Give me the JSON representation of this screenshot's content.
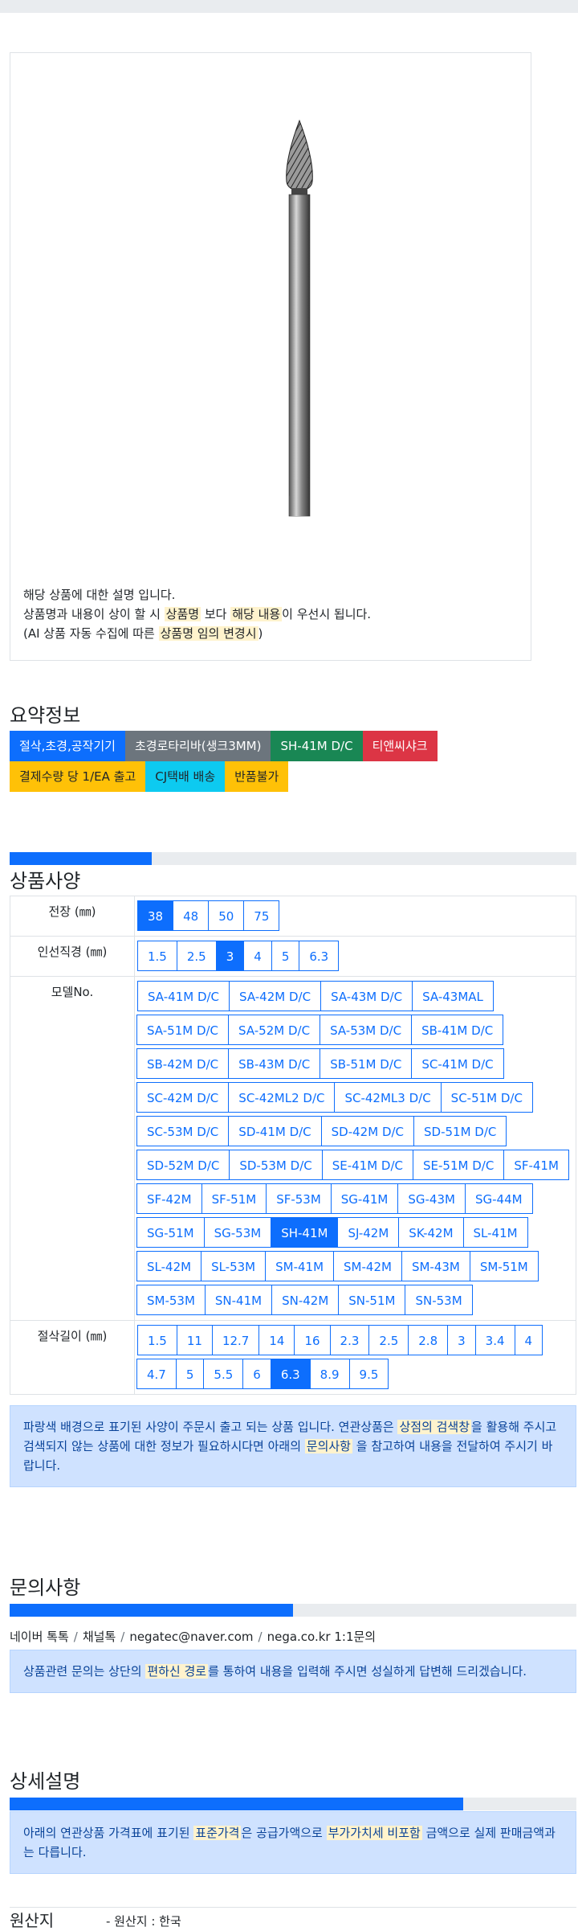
{
  "product": {
    "desc_line1": "해당 상품에 대한 설명 입니다.",
    "desc_line2_a": "상품명과 내용이 상이 할 시 ",
    "desc_line2_hl1": "상품명",
    "desc_line2_b": " 보다 ",
    "desc_line2_hl2": "해당 내용",
    "desc_line2_c": "이 우선시 됩니다.",
    "desc_line3_a": "(AI 상품 자동 수집에 따른 ",
    "desc_line3_hl": "상품명 임의 변경시",
    "desc_line3_b": ")"
  },
  "summary": {
    "title": "요약정보",
    "badges_row1": [
      {
        "label": "절삭,초경,공작기기",
        "color": "blue"
      },
      {
        "label": "초경로타리바(생크3MM)",
        "color": "gray"
      },
      {
        "label": "SH-41M D/C",
        "color": "green"
      },
      {
        "label": "티앤씨샤크",
        "color": "red"
      }
    ],
    "badges_row2": [
      {
        "label": "결제수량 당 1/EA 출고",
        "color": "yellow"
      },
      {
        "label": "CJ택배 배송",
        "color": "cyan"
      },
      {
        "label": "반품불가",
        "color": "yellow"
      }
    ]
  },
  "spec": {
    "title": "상품사양",
    "progress_percent": 25,
    "rows": [
      {
        "label": "전장 (㎜)",
        "options": [
          "38",
          "48",
          "50",
          "75"
        ],
        "selected": "38"
      },
      {
        "label": "인선직경 (㎜)",
        "options": [
          "1.5",
          "2.5",
          "3",
          "4",
          "5",
          "6.3"
        ],
        "selected": "3"
      },
      {
        "label": "모델No.",
        "options": [
          "SA-41M D/C",
          "SA-42M D/C",
          "SA-43M D/C",
          "SA-43MAL",
          "SA-51M D/C",
          "SA-52M D/C",
          "SA-53M D/C",
          "SB-41M D/C",
          "SB-42M D/C",
          "SB-43M D/C",
          "SB-51M D/C",
          "SC-41M D/C",
          "SC-42M D/C",
          "SC-42ML2 D/C",
          "SC-42ML3 D/C",
          "SC-51M D/C",
          "SC-53M D/C",
          "SD-41M D/C",
          "SD-42M D/C",
          "SD-51M D/C",
          "SD-52M D/C",
          "SD-53M D/C",
          "SE-41M D/C",
          "SE-51M D/C",
          "SF-41M",
          "SF-42M",
          "SF-51M",
          "SF-53M",
          "SG-41M",
          "SG-43M",
          "SG-44M",
          "SG-51M",
          "SG-53M",
          "SH-41M",
          "SJ-42M",
          "SK-42M",
          "SL-41M",
          "SL-42M",
          "SL-53M",
          "SM-41M",
          "SM-42M",
          "SM-43M",
          "SM-51M",
          "SM-53M",
          "SN-41M",
          "SN-42M",
          "SN-51M",
          "SN-53M"
        ],
        "selected": "SH-41M"
      },
      {
        "label": "절삭길이 (㎜)",
        "options": [
          "1.5",
          "11",
          "12.7",
          "14",
          "16",
          "2.3",
          "2.5",
          "2.8",
          "3",
          "3.4",
          "4",
          "4.7",
          "5",
          "5.5",
          "6",
          "6.3",
          "8.9",
          "9.5"
        ],
        "selected": "6.3"
      }
    ],
    "notice_a": "파랑색 배경으로 표기된 사양이 주문시 출고 되는 상품 입니다. 연관상품은 ",
    "notice_hl1": "상점의 검색창",
    "notice_b": "을 활용해 주시고 검색되지 않는 상품에 대한 정보가 필요하시다면 아래의 ",
    "notice_hl2": "문의사항",
    "notice_c": " 을 참고하여 내용을 전달하여 주시기 바랍니다."
  },
  "inquiry": {
    "title": "문의사항",
    "progress_percent": 50,
    "links": [
      "네이버 톡톡",
      "채널톡",
      "negatec@naver.com",
      "nega.co.kr 1:1문의"
    ],
    "notice_a": "상품관련 문의는 상단의 ",
    "notice_hl": "편하신 경로",
    "notice_b": "를 통하여 내용을 입력해 주시면 성실하게 답변해 드리겠습니다."
  },
  "detail": {
    "title": "상세설명",
    "progress_percent": 80,
    "notice_a": "아래의 연관상품 가격표에 표기된 ",
    "notice_hl1": "표준가격",
    "notice_b": "은 공급가액으로 ",
    "notice_hl2": "부가가치세 비포함",
    "notice_c": " 금액으로 실제 판매금액과는 다릅니다."
  },
  "origin": {
    "key": "원산지",
    "value": "- 원산지 : 한국"
  },
  "colors": {
    "primary": "#0d6efd",
    "highlight": "#fff3cd",
    "alert_bg": "#cfe2ff"
  }
}
